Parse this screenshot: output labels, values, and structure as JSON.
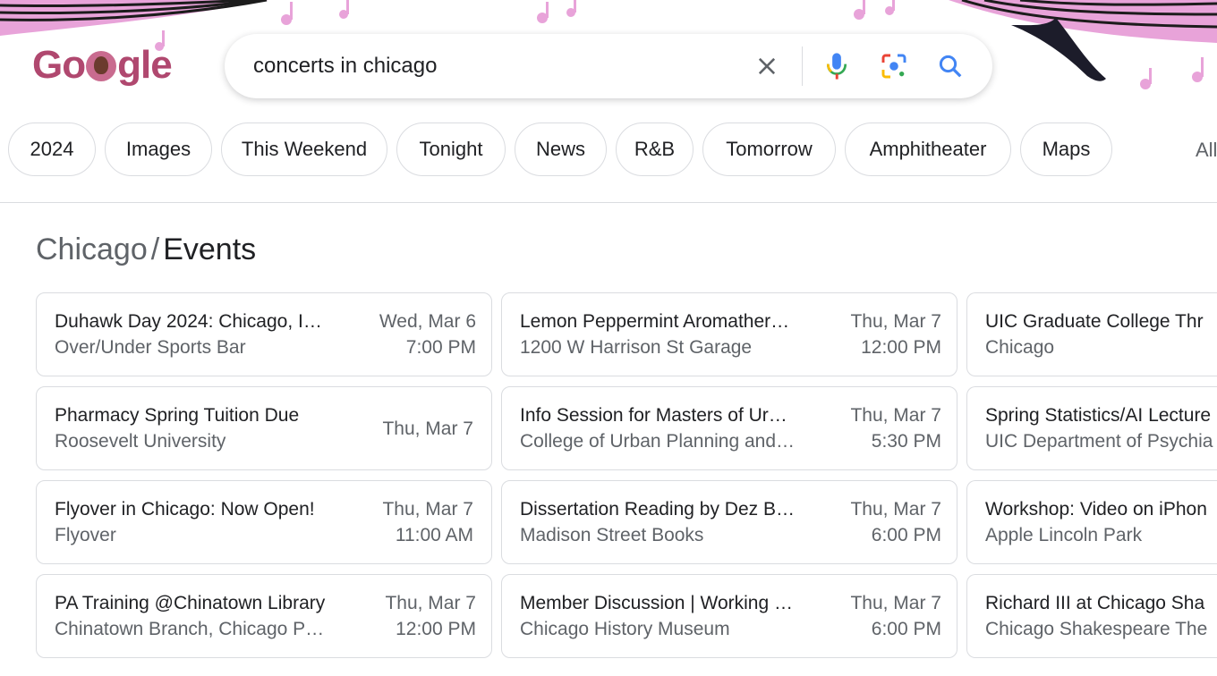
{
  "search": {
    "query": "concerts in chicago",
    "icons": [
      "close-icon",
      "mic-icon",
      "lens-icon",
      "search-icon"
    ]
  },
  "logo": {
    "text_left": "Go",
    "text_right": "gle"
  },
  "chips": [
    "2024",
    "Images",
    "This Weekend",
    "Tonight",
    "News",
    "R&B",
    "Tomorrow",
    "Amphitheater",
    "Maps"
  ],
  "all_filters_label": "All",
  "events": {
    "breadcrumb_city": "Chicago",
    "breadcrumb_sep": "/",
    "breadcrumb_section": "Events",
    "columns": [
      [
        {
          "title": "Duhawk Day 2024: Chicago, I…",
          "venue": "Over/Under Sports Bar",
          "date": "Wed, Mar 6",
          "time": "7:00 PM"
        },
        {
          "title": "Pharmacy Spring Tuition Due",
          "venue": "Roosevelt University",
          "date": "Thu, Mar 7",
          "time": ""
        },
        {
          "title": "Flyover in Chicago: Now Open!",
          "venue": "Flyover",
          "date": "Thu, Mar 7",
          "time": "11:00 AM"
        },
        {
          "title": "PA Training @Chinatown Library",
          "venue": "Chinatown Branch, Chicago P…",
          "date": "Thu, Mar 7",
          "time": "12:00 PM"
        }
      ],
      [
        {
          "title": "Lemon Peppermint Aromather…",
          "venue": "1200 W Harrison St Garage",
          "date": "Thu, Mar 7",
          "time": "12:00 PM"
        },
        {
          "title": "Info Session for Masters of Ur…",
          "venue": "College of Urban Planning and…",
          "date": "Thu, Mar 7",
          "time": "5:30 PM"
        },
        {
          "title": "Dissertation Reading by Dez B…",
          "venue": "Madison Street Books",
          "date": "Thu, Mar 7",
          "time": "6:00 PM"
        },
        {
          "title": "Member Discussion | Working …",
          "venue": "Chicago History Museum",
          "date": "Thu, Mar 7",
          "time": "6:00 PM"
        }
      ],
      [
        {
          "title": "UIC Graduate College Thr",
          "venue": "Chicago",
          "date": "",
          "time": ""
        },
        {
          "title": "Spring Statistics/AI Lecture",
          "venue": "UIC Department of Psychia",
          "date": "",
          "time": ""
        },
        {
          "title": "Workshop: Video on iPhon",
          "venue": "Apple Lincoln Park",
          "date": "",
          "time": ""
        },
        {
          "title": "Richard III at Chicago Sha",
          "venue": "Chicago Shakespeare The",
          "date": "",
          "time": ""
        }
      ]
    ]
  },
  "colors": {
    "doodle_pink": "#e8a3d9",
    "logo": "#b0486f",
    "text_primary": "#202124",
    "text_secondary": "#5f6368",
    "border": "#dadce0"
  }
}
